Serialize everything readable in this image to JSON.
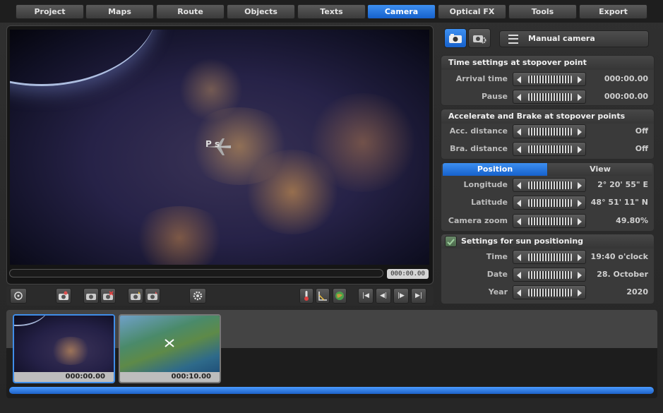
{
  "menu": {
    "tabs": [
      "Project",
      "Maps",
      "Route",
      "Objects",
      "Texts",
      "Camera",
      "Optical FX",
      "Tools",
      "Export"
    ],
    "active": "Camera"
  },
  "viewport": {
    "marker_label": "P  s",
    "time_display": "000:00.00"
  },
  "camera_mode": {
    "label": "Manual camera"
  },
  "time_settings": {
    "title": "Time settings at stopover point",
    "rows": [
      {
        "label": "Arrival time",
        "value": "000:00.00"
      },
      {
        "label": "Pause",
        "value": "000:00.00"
      }
    ]
  },
  "accel_brake": {
    "title": "Accelerate and Brake at stopover points",
    "rows": [
      {
        "label": "Acc. distance",
        "value": "Off"
      },
      {
        "label": "Bra. distance",
        "value": "Off"
      }
    ]
  },
  "position_view": {
    "tabs": [
      "Position",
      "View"
    ],
    "active": "Position",
    "rows": [
      {
        "label": "Longitude",
        "value": "2° 20' 55\" E"
      },
      {
        "label": "Latitude",
        "value": "48° 51' 11\" N"
      },
      {
        "label": "Camera zoom",
        "value": "49.80%"
      }
    ]
  },
  "sun": {
    "title": "Settings for sun positioning",
    "enabled": true,
    "rows": [
      {
        "label": "Time",
        "value": "19:40 o'clock"
      },
      {
        "label": "Date",
        "value": "28. October"
      },
      {
        "label": "Year",
        "value": "2020"
      }
    ]
  },
  "timeline": {
    "thumbs": [
      {
        "time": "000:00.00",
        "selected": true
      },
      {
        "time": "000:10.00",
        "selected": false
      }
    ]
  },
  "colors": {
    "accent": "#1f6fe0",
    "panel": "#3a3a3a"
  }
}
